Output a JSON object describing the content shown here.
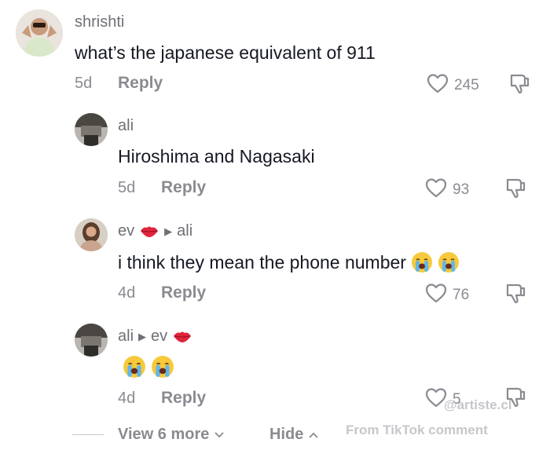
{
  "comments": [
    {
      "username": "shrishti",
      "text": "what’s the japanese equivalent of 911",
      "time": "5d",
      "reply_label": "Reply",
      "likes": "245"
    },
    {
      "username": "ali",
      "text": "Hiroshima and Nagasaki",
      "time": "5d",
      "reply_label": "Reply",
      "likes": "93"
    },
    {
      "username": "ev",
      "reply_to": "ali",
      "text": "i think they mean the phone number",
      "time": "4d",
      "reply_label": "Reply",
      "likes": "76"
    },
    {
      "username": "ali",
      "reply_to": "ev",
      "text": "",
      "time": "4d",
      "reply_label": "Reply",
      "likes": "5"
    }
  ],
  "footer": {
    "view_more": "View 6 more",
    "hide": "Hide"
  },
  "watermark": {
    "handle": "@artiste.cl",
    "source": "From TikTok comment"
  },
  "icons": {
    "like": "heart-outline-icon",
    "dislike": "thumbs-down-icon",
    "chevron_down": "chevron-down-icon",
    "chevron_up": "chevron-up-icon",
    "reply_arrow": "reply-arrow-icon",
    "cry": "crying-face-emoji",
    "kiss": "kiss-lips-emoji"
  },
  "colors": {
    "primary_text": "#161823",
    "secondary_text": "#8a8b91",
    "background": "#ffffff"
  }
}
